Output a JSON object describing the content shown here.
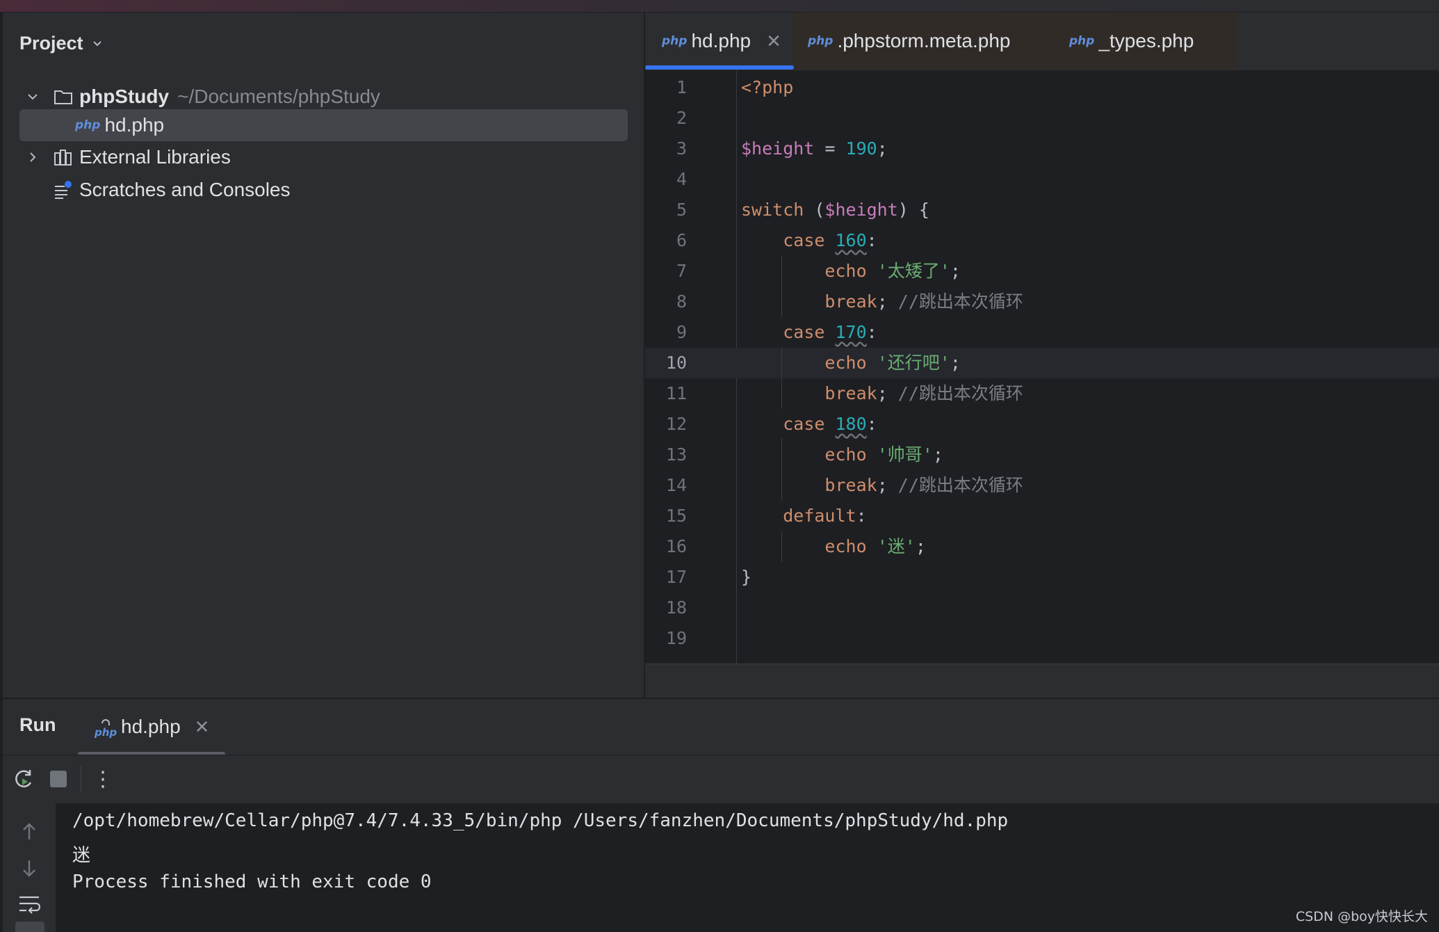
{
  "project": {
    "title": "Project",
    "tree": {
      "root_name": "phpStudy",
      "root_path": "~/Documents/phpStudy",
      "file": "hd.php",
      "external_libraries": "External Libraries",
      "scratches": "Scratches and Consoles"
    }
  },
  "editor": {
    "tabs": [
      {
        "badge": "php",
        "label": "hd.php",
        "active": true
      },
      {
        "badge": "php",
        "label": ".phpstorm.meta.php",
        "active": false
      },
      {
        "badge": "php",
        "label": "_types.php",
        "active": false
      }
    ],
    "current_line": 10,
    "lines": [
      {
        "n": "1",
        "text": "<?php"
      },
      {
        "n": "2",
        "text": ""
      },
      {
        "n": "3",
        "text": "$height = 190;"
      },
      {
        "n": "4",
        "text": ""
      },
      {
        "n": "5",
        "text": "switch ($height) {"
      },
      {
        "n": "6",
        "text": "    case 160:"
      },
      {
        "n": "7",
        "text": "        echo '太矮了';"
      },
      {
        "n": "8",
        "text": "        break; //跳出本次循环"
      },
      {
        "n": "9",
        "text": "    case 170:"
      },
      {
        "n": "10",
        "text": "        echo '还行吧';"
      },
      {
        "n": "11",
        "text": "        break; //跳出本次循环"
      },
      {
        "n": "12",
        "text": "    case 180:"
      },
      {
        "n": "13",
        "text": "        echo '帅哥';"
      },
      {
        "n": "14",
        "text": "        break; //跳出本次循环"
      },
      {
        "n": "15",
        "text": "    default:"
      },
      {
        "n": "16",
        "text": "        echo '迷';"
      },
      {
        "n": "17",
        "text": "}"
      },
      {
        "n": "18",
        "text": ""
      },
      {
        "n": "19",
        "text": ""
      }
    ]
  },
  "run": {
    "title": "Run",
    "tab_badge": "php",
    "tab_label": "hd.php",
    "console": {
      "command": "/opt/homebrew/Cellar/php@7.4/7.4.33_5/bin/php /Users/fanzhen/Documents/phpStudy/hd.php",
      "output": "迷",
      "status": "Process finished with exit code 0"
    }
  },
  "watermark": "CSDN @boy快快长大",
  "colors": {
    "keyword": "#cf8e6d",
    "variable": "#c77dbb",
    "number": "#2aacb8",
    "string": "#6aab73",
    "comment": "#7a7e85",
    "accent": "#3574f0"
  }
}
